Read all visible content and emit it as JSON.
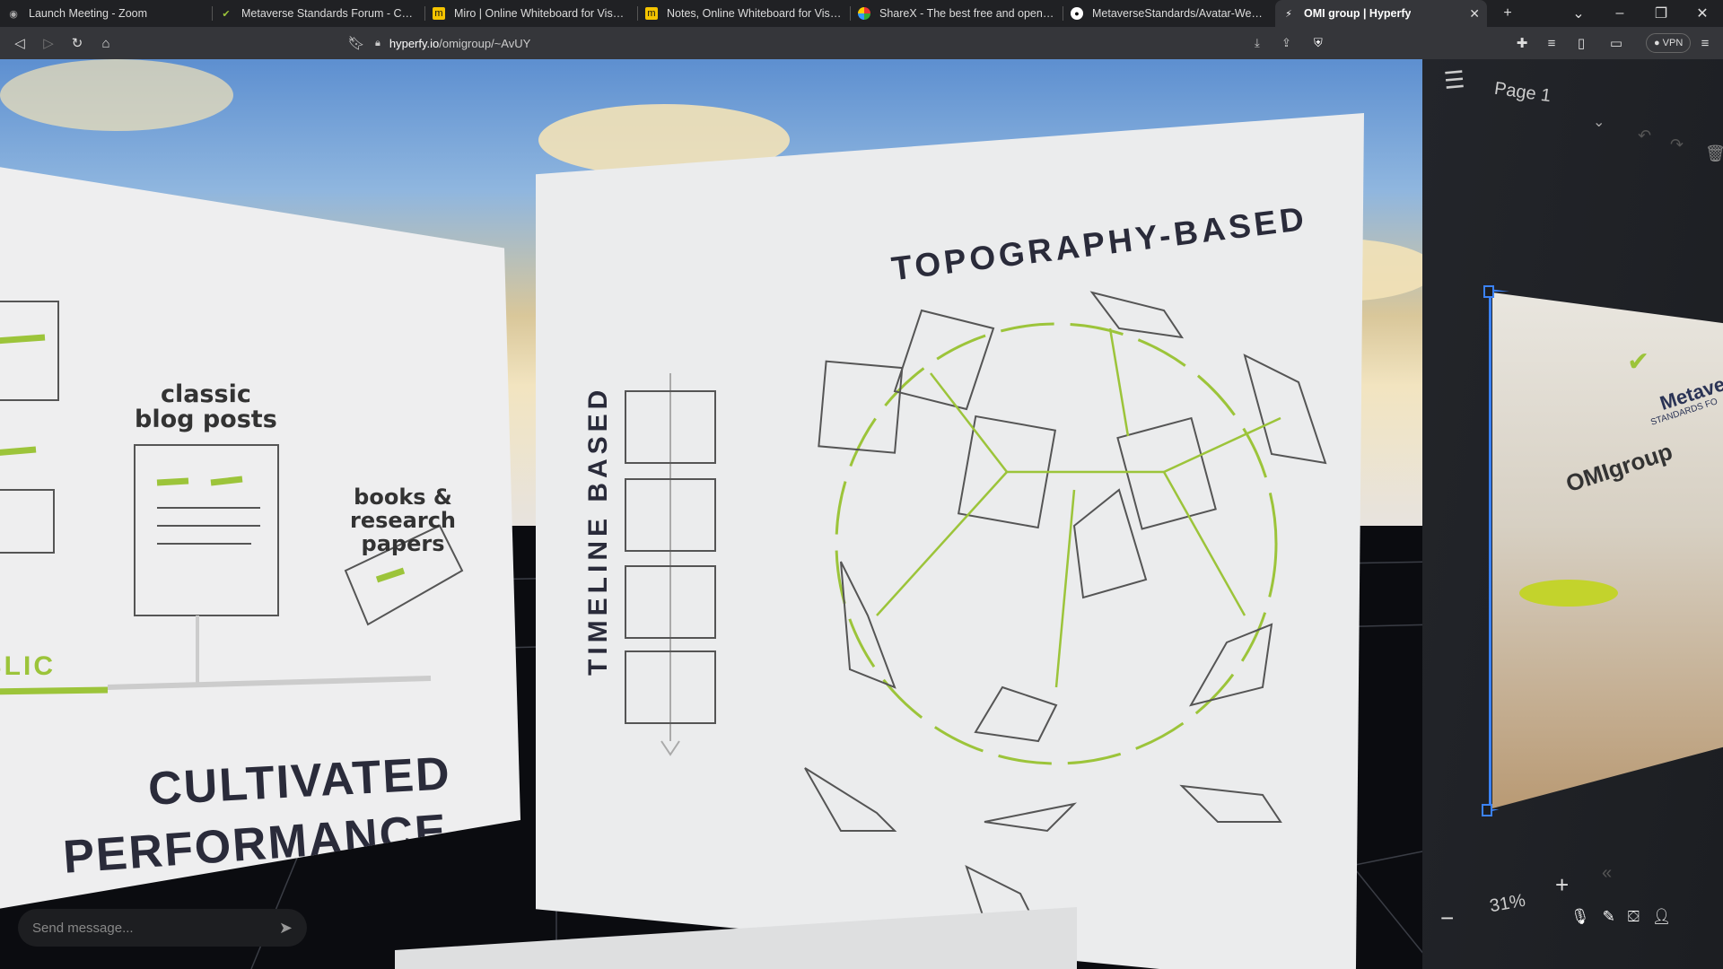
{
  "tabs": [
    {
      "title": "Launch Meeting - Zoom",
      "icon": "zoom-icon"
    },
    {
      "title": "Metaverse Standards Forum - Chairs",
      "icon": "msf-icon"
    },
    {
      "title": "Miro | Online Whiteboard for Visual C",
      "icon": "miro-icon"
    },
    {
      "title": "Notes, Online Whiteboard for Visual C",
      "icon": "miro-icon"
    },
    {
      "title": "ShareX - The best free and open sou",
      "icon": "sharex-icon"
    },
    {
      "title": "MetaverseStandards/Avatar-Wearabl",
      "icon": "github-icon"
    },
    {
      "title": "OMI group | Hyperfy",
      "icon": "hyperfy-icon",
      "active": true
    }
  ],
  "address": {
    "domain": "hyperfy.io",
    "path": "/omigroup/~AvUY"
  },
  "toolbar": {
    "vpn_label": "VPN"
  },
  "boards": {
    "left": {
      "blog": "classic\nblog posts",
      "books": "books &\nresearch\npapers",
      "public": "BLIC",
      "cultivated": "CULTIVATED",
      "performance": "PERFORMANCE"
    },
    "center": {
      "timeline": "TIMELINE BASED",
      "topography": "TOPOGRAPHY-BASED"
    }
  },
  "whiteboard": {
    "page_label": "Page 1",
    "zoom": "31%",
    "image_text_1": "Metaverse",
    "image_text_2": "STANDARDS FO",
    "image_text_3": "OMIgroup"
  },
  "chat": {
    "placeholder": "Send message..."
  },
  "colors": {
    "accent_green": "#9cc43a",
    "toolbar": "#35363a",
    "tabbar": "#202124"
  }
}
